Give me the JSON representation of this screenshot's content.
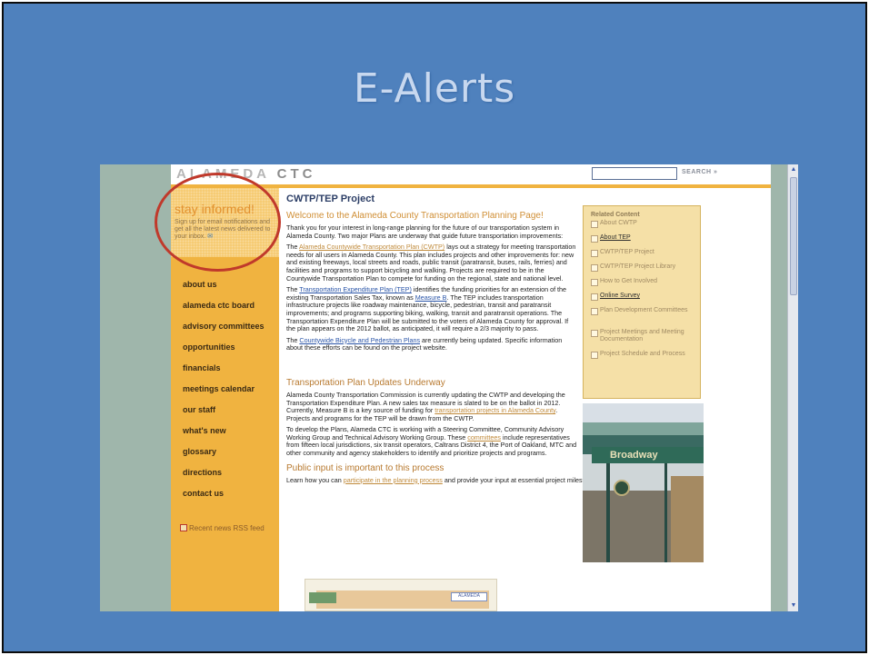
{
  "slide": {
    "title": "E-Alerts"
  },
  "colors": {
    "slide_bg": "#4f81bd",
    "sidebar": "#f0b340",
    "accent_circle": "#c0392b"
  },
  "site": {
    "logo_main": "ALAMEDA",
    "logo_sub": "CTC",
    "search_button": "SEARCH »",
    "search_placeholder": ""
  },
  "stay_informed": {
    "title": "stay informed!",
    "text": "Sign up for email notifications and get all the latest news delivered to your inbox."
  },
  "nav": [
    "about us",
    "alameda ctc board",
    "advisory committees",
    "opportunities",
    "financials",
    "meetings calendar",
    "our staff",
    "what's new",
    "glossary",
    "directions",
    "contact us"
  ],
  "rss": {
    "label": "Recent news RSS feed"
  },
  "content": {
    "page_title": "CWTP/TEP Project",
    "welcome": "Welcome to the Alameda County Transportation Planning Page!",
    "intro": "Thank you for your interest in long-range planning for the future of our transportation system in Alameda County. Two major Plans are underway that guide future transportation improvements:",
    "p1_pre": "The ",
    "p1_link": "Alameda Countywide Transportation Plan (CWTP)",
    "p1_post": " lays out a strategy for meeting transportation needs for all users in Alameda County. This plan includes projects and other improvements for: new and existing freeways, local streets and roads, public transit (paratransit, buses, rails, ferries) and facilities and programs to support bicycling and walking. Projects are required to be in the Countywide Transportation Plan to compete for funding on the regional, state and national level.",
    "p2_pre": "The ",
    "p2_link": "Transportation Expenditure Plan (TEP)",
    "p2_mid": " identifies the funding priorities for an extension of the existing Transportation Sales Tax, known as ",
    "p2_link2": "Measure B",
    "p2_post": ". The TEP includes transportation infrastructure projects like roadway maintenance, bicycle, pedestrian, transit and paratransit improvements; and programs supporting biking, walking, transit and paratransit operations. The Transportation Expenditure Plan will be submitted to the voters of Alameda County for approval. If the plan appears on the 2012 ballot, as anticipated, it will require a 2/3 majority to pass.",
    "p3_pre": "The ",
    "p3_link": "Countywide Bicycle and Pedestrian Plans",
    "p3_post": " are currently being updated. Specific information about these efforts can be found on the project website.",
    "h_updates": "Transportation Plan Updates Underway",
    "p4_pre": "Alameda County Transportation Commission is currently updating the CWTP and developing the Transportation Expenditure Plan. A new sales tax measure is slated to be on the ballot in 2012. Currently, Measure B is a key source of funding for ",
    "p4_link": "transportation projects in Alameda County",
    "p4_post": ". Projects and programs for the TEP will be drawn from the CWTP.",
    "p5_pre": "To develop the Plans, Alameda CTC is working with a Steering Committee, Community Advisory Working Group and Technical Advisory Working Group. These ",
    "p5_link": "committees",
    "p5_post": " include representatives from fifteen local jurisdictions, six transit operators, Caltrans District 4, the Port of Oakland, MTC and other community and agency stakeholders to identify and prioritize projects and programs.",
    "h_public": "Public input is important to this process",
    "p6_pre": "Learn how you can ",
    "p6_link": "participate in the planning process",
    "p6_post": " and provide your input at essential project milestones."
  },
  "related": {
    "heading": "Related Content",
    "items": [
      "About CWTP",
      "About TEP",
      "CWTP/TEP Project",
      "CWTP/TEP Project Library",
      "How to Get Involved",
      "Online Survey",
      "Plan Development Committees",
      "Project Meetings and Meeting Documentation",
      "Project Schedule and Process"
    ]
  },
  "photo": {
    "sign_text": "Broadway"
  },
  "diagram": {
    "label": "ALAMEDA"
  }
}
